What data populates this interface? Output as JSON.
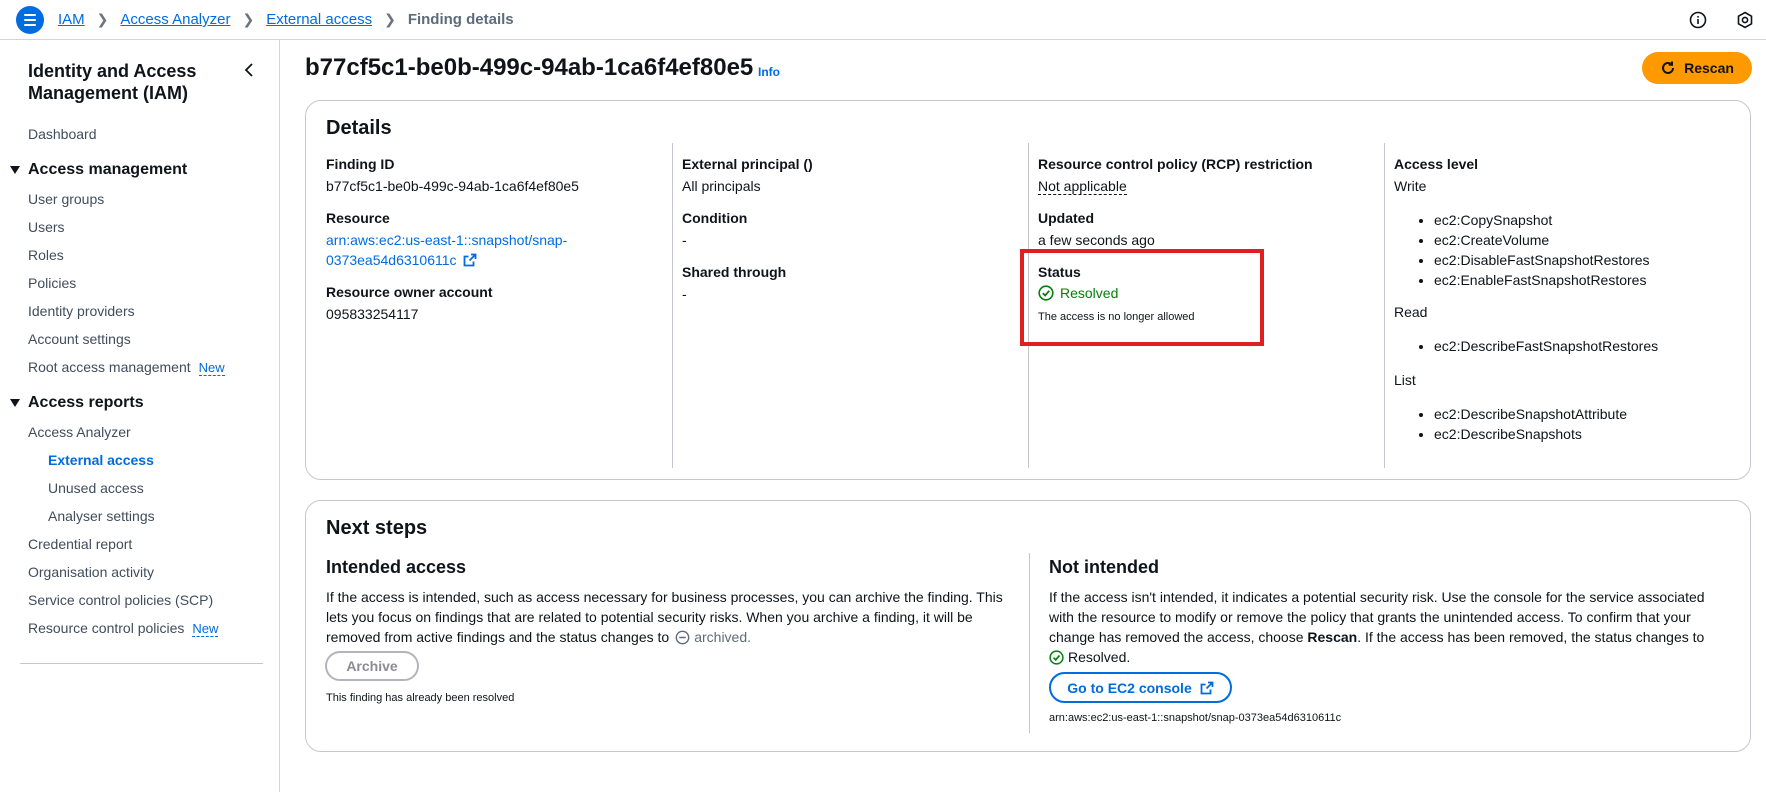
{
  "breadcrumb": {
    "items": [
      "IAM",
      "Access Analyzer",
      "External access"
    ],
    "current": "Finding details"
  },
  "sidebar": {
    "title": "Identity and Access Management (IAM)",
    "dashboard": "Dashboard",
    "access_management": {
      "label": "Access management",
      "items": [
        "User groups",
        "Users",
        "Roles",
        "Policies",
        "Identity providers",
        "Account settings",
        "Root access management"
      ],
      "root_badge": "New"
    },
    "access_reports": {
      "label": "Access reports",
      "access_analyzer": "Access Analyzer",
      "sub_items": [
        "External access",
        "Unused access",
        "Analyser settings"
      ],
      "items": [
        "Credential report",
        "Organisation activity",
        "Service control policies (SCP)",
        "Resource control policies"
      ],
      "rcp_badge": "New"
    }
  },
  "header": {
    "title": "b77cf5c1-be0b-499c-94ab-1ca6f4ef80e5",
    "info": "Info",
    "rescan": "Rescan"
  },
  "details": {
    "title": "Details",
    "finding_id_label": "Finding ID",
    "finding_id": "b77cf5c1-be0b-499c-94ab-1ca6f4ef80e5",
    "resource_label": "Resource",
    "resource_line1": "arn:aws:ec2:us-east-1::snapshot/snap-",
    "resource_line2": "0373ea54d6310611c",
    "owner_label": "Resource owner account",
    "owner": "095833254117",
    "principal_label": "External principal ()",
    "principal": "All principals",
    "condition_label": "Condition",
    "condition": "-",
    "shared_label": "Shared through",
    "shared": "-",
    "rcp_label": "Resource control policy (RCP) restriction",
    "rcp": "Not applicable",
    "updated_label": "Updated",
    "updated": "a few seconds ago",
    "status_label": "Status",
    "status": "Resolved",
    "status_note": "The access is no longer allowed",
    "access_level_label": "Access level",
    "write_label": "Write",
    "write": [
      "ec2:CopySnapshot",
      "ec2:CreateVolume",
      "ec2:DisableFastSnapshotRestores",
      "ec2:EnableFastSnapshotRestores"
    ],
    "read_label": "Read",
    "read": [
      "ec2:DescribeFastSnapshotRestores"
    ],
    "list_label": "List",
    "list": [
      "ec2:DescribeSnapshotAttribute",
      "ec2:DescribeSnapshots"
    ]
  },
  "next_steps": {
    "title": "Next steps",
    "intended_title": "Intended access",
    "intended_line1": "If the access is intended, such as access necessary for business processes, you can archive the finding. This",
    "intended_line2": "lets you focus on findings that are related to potential security risks. When you archive a finding, it will be",
    "intended_line3": "removed from active findings and the status changes to",
    "archived": "archived.",
    "archive_button": "Archive",
    "archive_note": "This finding has already been resolved",
    "not_intended_title": "Not intended",
    "not_line1": "If the access isn't intended, it indicates a potential security risk. Use the console for the service associated",
    "not_line2": "with the resource to modify or remove the policy that grants the unintended access. To confirm that your",
    "not_line3a": "change has removed the access, choose",
    "not_line3b": "Rescan",
    "not_line3c": ". If the access has been removed, the status changes to",
    "resolved": "Resolved.",
    "ec2_button": "Go to EC2 console",
    "arn": "arn:aws:ec2:us-east-1::snapshot/snap-0373ea54d6310611c"
  },
  "colors": {
    "link": "#006ce0",
    "primary_button": "#ff9900",
    "success": "#037f0c",
    "highlight": "#e02020"
  }
}
